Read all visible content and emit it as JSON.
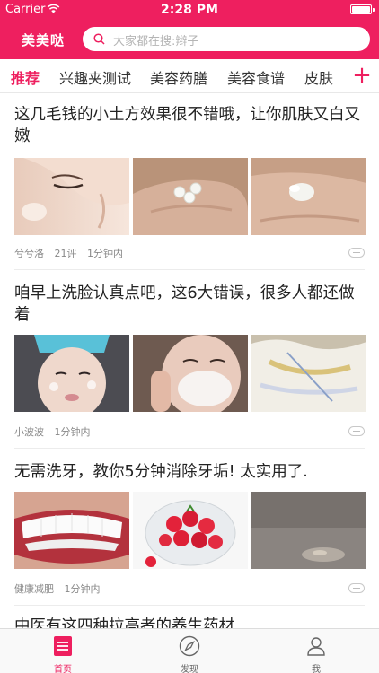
{
  "status_bar": {
    "carrier": "Carrier",
    "time": "2:28 PM"
  },
  "header": {
    "app_title": "美美哒",
    "search_placeholder": "大家都在搜:辫子"
  },
  "tabs": [
    {
      "label": "推荐",
      "active": true
    },
    {
      "label": "兴趣夹测试",
      "active": false
    },
    {
      "label": "美容药膳",
      "active": false
    },
    {
      "label": "美容食谱",
      "active": false
    },
    {
      "label": "皮肤",
      "active": false
    }
  ],
  "tab_add_label": "+",
  "articles": [
    {
      "title": "这几毛钱的小土方效果很不错哦，让你肌肤又白又嫩",
      "author": "兮兮洛",
      "comments": "21评",
      "time": "1分钟内",
      "images": [
        "face-skin-photo",
        "hand-pills-photo",
        "hand-paste-photo"
      ]
    },
    {
      "title": "咱早上洗脸认真点吧，这6大错误，很多人都还做着",
      "author": "小波波",
      "comments": "",
      "time": "1分钟内",
      "images": [
        "face-foam-photo",
        "face-wash-photo",
        "towel-photo"
      ]
    },
    {
      "title": "无需洗牙，教你5分钟消除牙垢! 太实用了.",
      "author": "健康减肥",
      "comments": "",
      "time": "1分钟内",
      "images": [
        "teeth-smile-photo",
        "strawberries-photo",
        "countertop-photo"
      ]
    },
    {
      "title": "中医有这四种拉高者的养生药材",
      "author": "",
      "comments": "",
      "time": "",
      "images": []
    }
  ],
  "tab_bar": [
    {
      "label": "首页",
      "icon": "home-doc-icon",
      "active": true
    },
    {
      "label": "发现",
      "icon": "compass-icon",
      "active": false
    },
    {
      "label": "我",
      "icon": "profile-icon",
      "active": false
    }
  ],
  "colors": {
    "accent": "#ee1f5f",
    "text": "#222222",
    "meta": "#888888"
  }
}
